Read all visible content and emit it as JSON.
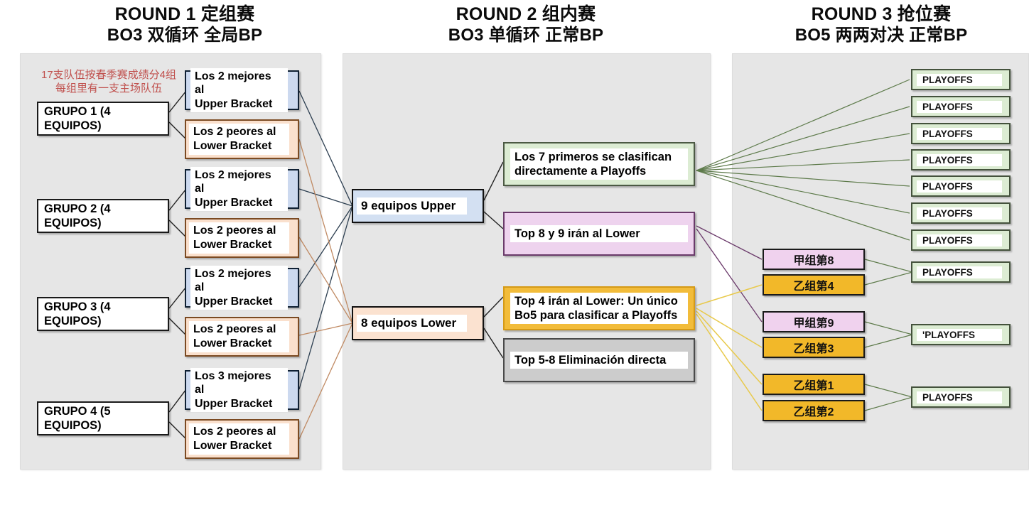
{
  "rounds": [
    {
      "title": "ROUND 1 定组赛",
      "subtitle": "BO3 双循环 全局BP"
    },
    {
      "title": "ROUND 2 组内赛",
      "subtitle": "BO3 单循环 正常BP"
    },
    {
      "title": "ROUND 3 抢位赛",
      "subtitle": "BO5  两两对决 正常BP"
    }
  ],
  "note": {
    "line1": "17支队伍按春季赛成绩分4组",
    "line2": "每组里有一支主场队伍"
  },
  "round1": {
    "groups": [
      {
        "label": "GRUPO 1 (4 EQUIPOS)"
      },
      {
        "label": "GRUPO 2 (4 EQUIPOS)"
      },
      {
        "label": "GRUPO 3 (4 EQUIPOS)"
      },
      {
        "label": "GRUPO 4 (5 EQUIPOS)"
      }
    ],
    "brackets": [
      {
        "line1": "Los 2 mejores al",
        "line2": "Upper Bracket"
      },
      {
        "line1": "Los 2 peores al",
        "line2": "Lower Bracket"
      },
      {
        "line1": "Los 2 mejores al",
        "line2": "Upper Bracket"
      },
      {
        "line1": "Los 2 peores al",
        "line2": "Lower Bracket"
      },
      {
        "line1": "Los 2 mejores al",
        "line2": "Upper Bracket"
      },
      {
        "line1": "Los 2 peores al",
        "line2": "Lower Bracket"
      },
      {
        "line1": "Los 3 mejores al",
        "line2": "Upper Bracket"
      },
      {
        "line1": "Los 2 peores al",
        "line2": "Lower Bracket"
      }
    ]
  },
  "round2": {
    "pool_upper": "9 equipos Upper",
    "pool_lower": "8 equipos Lower",
    "outcomes": [
      {
        "line1": "Los 7 primeros se clasifican",
        "line2": "directamente a Playoffs"
      },
      {
        "line1": "Top 8 y 9 irán al Lower",
        "line2": ""
      },
      {
        "line1": "Top 4 irán al Lower: Un único",
        "line2": "Bo5 para clasificar a Playoffs"
      },
      {
        "line1": "Top 5-8 Eliminación directa",
        "line2": ""
      }
    ]
  },
  "round3": {
    "playoffs_label": "PLAYOFFS",
    "playoffs_direct_count": 7,
    "matches": [
      {
        "a": "甲组第8",
        "b": "乙组第4",
        "winner": "PLAYOFFS"
      },
      {
        "a": "甲组第9",
        "b": "乙组第3",
        "winner": "'PLAYOFFS"
      },
      {
        "a": "乙组第1",
        "b": "乙组第2",
        "winner": "PLAYOFFS"
      }
    ]
  },
  "colors": {
    "panel_bg": "#e6e6e6",
    "note_red": "#c0504d",
    "wire_upper": "#2c3e50",
    "wire_lower": "#c08a63",
    "wire_green": "#5d7a4a",
    "wire_purple": "#6b3a6b",
    "wire_amber": "#e8c94a",
    "upper_fill": "#ccd9ef",
    "lower_fill": "#fae0cd",
    "green_fill": "#dcecd3",
    "purple_fill": "#eed3ee",
    "amber_fill": "#f2bc3a",
    "gray_fill": "#cccccc"
  }
}
